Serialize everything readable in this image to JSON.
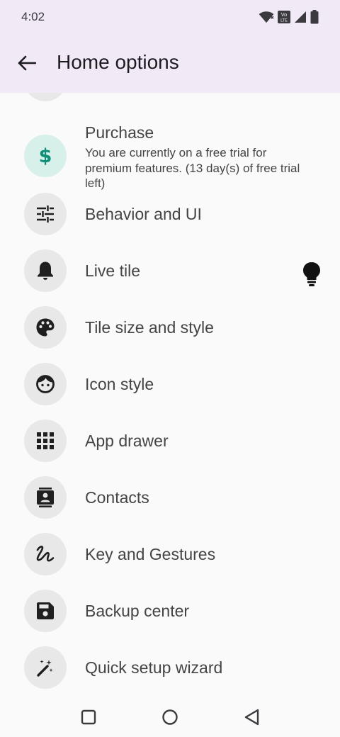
{
  "status_bar": {
    "time": "4:02",
    "icons": [
      "wifi-icon",
      "volte-icon",
      "signal-icon",
      "battery-icon"
    ]
  },
  "app_bar": {
    "title": "Home options",
    "back_icon": "arrow-back-icon"
  },
  "purchase": {
    "label": "Purchase",
    "description": "You are currently on a free trial for premium features. (13 day(s) of free trial left)",
    "icon": "dollar-icon",
    "icon_symbol": "$"
  },
  "items": [
    {
      "label": "Behavior and UI",
      "icon": "tune-icon"
    },
    {
      "label": "Live tile",
      "icon": "bell-icon",
      "trailing_icon": "lightbulb-icon"
    },
    {
      "label": "Tile size and style",
      "icon": "palette-icon"
    },
    {
      "label": "Icon style",
      "icon": "face-icon"
    },
    {
      "label": "App drawer",
      "icon": "apps-grid-icon"
    },
    {
      "label": "Contacts",
      "icon": "contacts-icon"
    },
    {
      "label": "Key and Gestures",
      "icon": "gesture-icon"
    },
    {
      "label": "Backup center",
      "icon": "save-icon"
    },
    {
      "label": "Quick setup wizard",
      "icon": "magic-wand-icon"
    }
  ],
  "nav_bar": {
    "icons": [
      "recents-icon",
      "home-icon",
      "back-icon"
    ]
  },
  "colors": {
    "top_bar_background": "#f1e9f6",
    "page_background": "#fafafa",
    "icon_circle": "#e8e8e8",
    "purchase_circle": "#d8f0ea",
    "purchase_accent": "#0e8f77",
    "icon_color": "#1f1f1f"
  }
}
